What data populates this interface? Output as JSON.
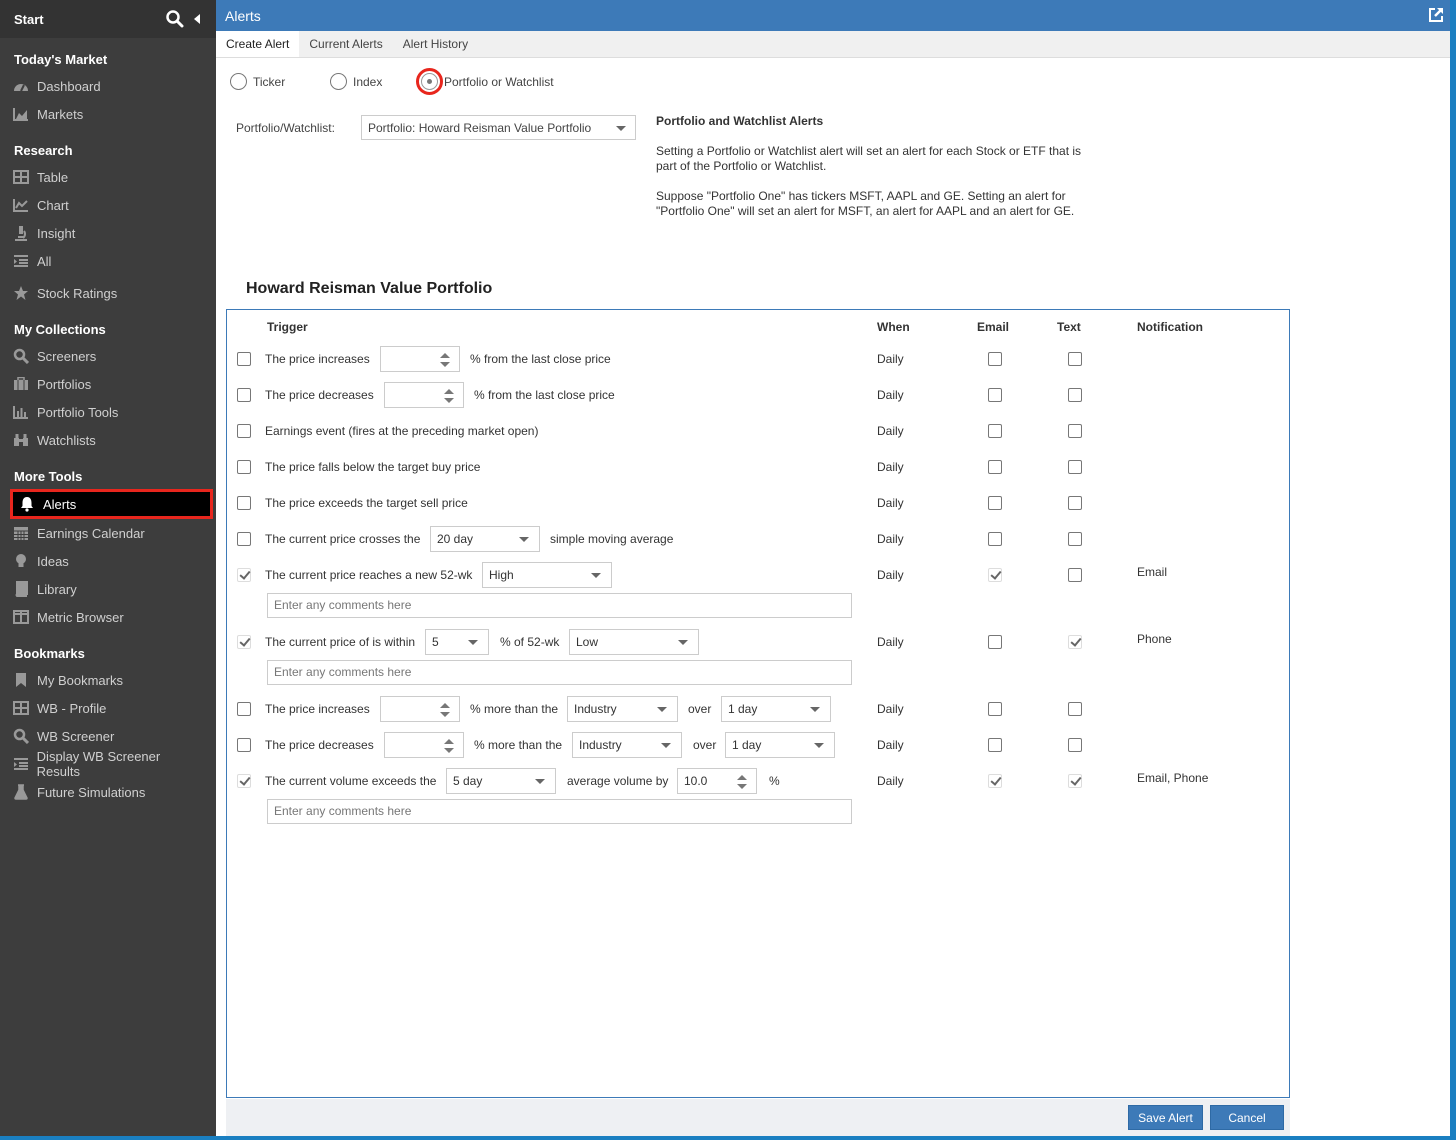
{
  "sidebar": {
    "start": "Start",
    "sections": [
      {
        "title": "Today's Market",
        "items": [
          {
            "label": "Dashboard",
            "icon": "gauge-icon"
          },
          {
            "label": "Markets",
            "icon": "area-chart-icon"
          }
        ]
      },
      {
        "title": "Research",
        "items": [
          {
            "label": "Table",
            "icon": "table-icon"
          },
          {
            "label": "Chart",
            "icon": "line-chart-icon"
          },
          {
            "label": "Insight",
            "icon": "microscope-icon"
          },
          {
            "label": "All",
            "icon": "list-indent-icon"
          },
          {
            "label": "Stock Ratings",
            "icon": "star-half-icon"
          }
        ]
      },
      {
        "title": "My Collections",
        "items": [
          {
            "label": "Screeners",
            "icon": "search-icon"
          },
          {
            "label": "Portfolios",
            "icon": "briefcase-icon"
          },
          {
            "label": "Portfolio Tools",
            "icon": "bar-chart-icon"
          },
          {
            "label": "Watchlists",
            "icon": "binoculars-icon"
          }
        ]
      },
      {
        "title": "More Tools",
        "items": [
          {
            "label": "Alerts",
            "icon": "bell-icon",
            "active": true
          },
          {
            "label": "Earnings Calendar",
            "icon": "calendar-icon"
          },
          {
            "label": "Ideas",
            "icon": "lightbulb-icon"
          },
          {
            "label": "Library",
            "icon": "book-icon"
          },
          {
            "label": "Metric Browser",
            "icon": "columns-icon"
          }
        ]
      },
      {
        "title": "Bookmarks",
        "items": [
          {
            "label": "My Bookmarks",
            "icon": "bookmark-icon"
          },
          {
            "label": "WB - Profile",
            "icon": "table-icon"
          },
          {
            "label": "WB Screener",
            "icon": "search-icon"
          },
          {
            "label": "Display WB Screener Results",
            "icon": "list-indent-icon"
          },
          {
            "label": "Future Simulations",
            "icon": "flask-icon"
          }
        ]
      }
    ]
  },
  "header": {
    "title": "Alerts"
  },
  "tabs": [
    "Create Alert",
    "Current Alerts",
    "Alert History"
  ],
  "radios": {
    "ticker": "Ticker",
    "index": "Index",
    "portfolio": "Portfolio or Watchlist",
    "selected": "portfolio"
  },
  "portfolio_label": "Portfolio/Watchlist:",
  "portfolio_value": "Portfolio:  Howard Reisman Value Portfolio",
  "info": {
    "title": "Portfolio and Watchlist Alerts",
    "p1": "Setting a Portfolio or Watchlist alert will set an alert for each Stock or ETF that is part of the Portfolio or Watchlist.",
    "p2": "Suppose \"Portfolio One\" has tickers MSFT, AAPL and GE. Setting an alert for \"Portfolio One\" will set an alert for MSFT, an alert for AAPL and an alert for GE."
  },
  "portfolio_title": "Howard Reisman Value Portfolio",
  "columns": {
    "trigger": "Trigger",
    "when": "When",
    "email": "Email",
    "text": "Text",
    "notification": "Notification"
  },
  "rows": [
    {
      "pre": "The price increases",
      "post": "% from the last close price",
      "when": "Daily"
    },
    {
      "pre": "The price decreases",
      "post": "% from the last close price",
      "when": "Daily"
    },
    {
      "pre": "Earnings event (fires at the preceding market open)",
      "when": "Daily"
    },
    {
      "pre": "The price falls below the target buy price",
      "when": "Daily"
    },
    {
      "pre": "The price exceeds the target sell price",
      "when": "Daily"
    },
    {
      "pre": "The current price crosses the",
      "select": "20 day",
      "post": "simple moving average",
      "when": "Daily"
    },
    {
      "pre": "The current price reaches a new 52-wk",
      "select": "High",
      "when": "Daily",
      "notification": "Email"
    },
    {
      "pre": "The current price of is within",
      "spin": "5",
      "mid": "% of 52-wk",
      "select": "Low",
      "when": "Daily",
      "notification": "Phone"
    },
    {
      "pre": "The price increases",
      "mid": "% more than the",
      "select": "Industry",
      "over": "over",
      "period": "1 day",
      "when": "Daily"
    },
    {
      "pre": "The price decreases",
      "mid": "% more than the",
      "select": "Industry",
      "over": "over",
      "period": "1 day",
      "when": "Daily"
    },
    {
      "pre": "The current volume exceeds the",
      "select": "5 day",
      "mid": "average volume by",
      "spin": "10.0",
      "post": "%",
      "when": "Daily",
      "notification": "Email, Phone"
    }
  ],
  "comment_placeholder": "Enter any comments here",
  "buttons": {
    "save": "Save Alert",
    "cancel": "Cancel"
  },
  "colors": {
    "accent": "#3d7ab8",
    "highlight": "#e8261d",
    "sidebar": "#3d3d3d"
  }
}
